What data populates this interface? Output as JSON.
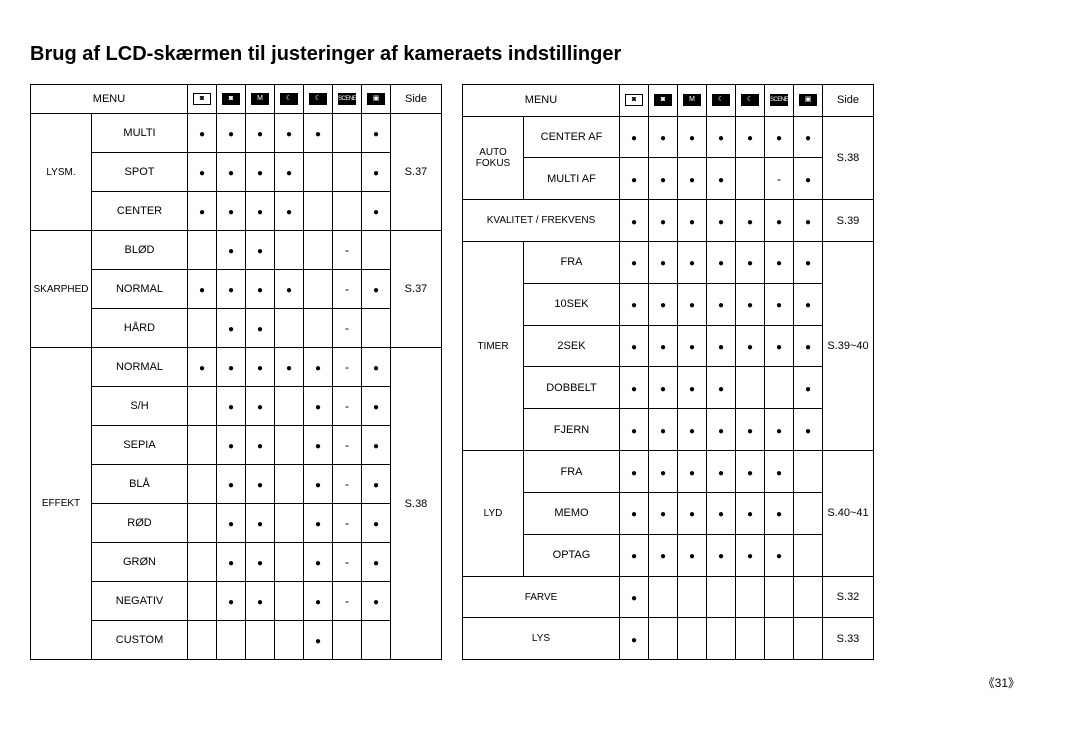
{
  "page_title": "Brug af LCD-skærmen til justeringer af kameraets indstillinger",
  "page_number": "《31》",
  "headers": {
    "menu": "MENU",
    "side": "Side",
    "mode_icons": [
      "cam",
      "cam2",
      "M",
      "night",
      "night2",
      "SCENE",
      "movie"
    ]
  },
  "table_left": {
    "groups": [
      {
        "name": "LYSM.",
        "side": "S.37",
        "rows": [
          {
            "label": "MULTI",
            "cells": [
              "d",
              "d",
              "d",
              "d",
              "d",
              "",
              "d"
            ]
          },
          {
            "label": "SPOT",
            "cells": [
              "d",
              "d",
              "d",
              "d",
              "",
              "",
              "d"
            ]
          },
          {
            "label": "CENTER",
            "cells": [
              "d",
              "d",
              "d",
              "d",
              "",
              "",
              "d"
            ]
          }
        ]
      },
      {
        "name": "SKARPHED",
        "side": "S.37",
        "rows": [
          {
            "label": "BLØD",
            "cells": [
              "",
              "d",
              "d",
              "",
              "",
              "-",
              ""
            ]
          },
          {
            "label": "NORMAL",
            "cells": [
              "d",
              "d",
              "d",
              "d",
              "",
              "-",
              "d"
            ]
          },
          {
            "label": "HÅRD",
            "cells": [
              "",
              "d",
              "d",
              "",
              "",
              "-",
              ""
            ]
          }
        ]
      },
      {
        "name": "EFFEKT",
        "side": "S.38",
        "rows": [
          {
            "label": "NORMAL",
            "cells": [
              "d",
              "d",
              "d",
              "d",
              "d",
              "-",
              "d"
            ]
          },
          {
            "label": "S/H",
            "cells": [
              "",
              "d",
              "d",
              "",
              "d",
              "-",
              "d"
            ]
          },
          {
            "label": "SEPIA",
            "cells": [
              "",
              "d",
              "d",
              "",
              "d",
              "-",
              "d"
            ]
          },
          {
            "label": "BLÅ",
            "cells": [
              "",
              "d",
              "d",
              "",
              "d",
              "-",
              "d"
            ]
          },
          {
            "label": "RØD",
            "cells": [
              "",
              "d",
              "d",
              "",
              "d",
              "-",
              "d"
            ]
          },
          {
            "label": "GRØN",
            "cells": [
              "",
              "d",
              "d",
              "",
              "d",
              "-",
              "d"
            ]
          },
          {
            "label": "NEGATIV",
            "cells": [
              "",
              "d",
              "d",
              "",
              "d",
              "-",
              "d"
            ]
          },
          {
            "label": "CUSTOM",
            "cells": [
              "",
              "",
              "",
              "",
              "d",
              "",
              ""
            ]
          }
        ]
      }
    ]
  },
  "table_right": {
    "groups": [
      {
        "name": "AUTO FOKUS",
        "side": "S.38",
        "rows": [
          {
            "label": "CENTER AF",
            "cells": [
              "d",
              "d",
              "d",
              "d",
              "d",
              "d",
              "d"
            ]
          },
          {
            "label": "MULTI AF",
            "cells": [
              "d",
              "d",
              "d",
              "d",
              "",
              "-",
              "d"
            ]
          }
        ]
      },
      {
        "name_span": "KVALITET / FREKVENS",
        "side": "S.39",
        "rows": [
          {
            "label_full": true,
            "cells": [
              "d",
              "d",
              "d",
              "d",
              "d",
              "d",
              "d"
            ]
          }
        ]
      },
      {
        "name": "TIMER",
        "side": "S.39~40",
        "rows": [
          {
            "label": "FRA",
            "cells": [
              "d",
              "d",
              "d",
              "d",
              "d",
              "d",
              "d"
            ]
          },
          {
            "label": "10SEK",
            "cells": [
              "d",
              "d",
              "d",
              "d",
              "d",
              "d",
              "d"
            ]
          },
          {
            "label": "2SEK",
            "cells": [
              "d",
              "d",
              "d",
              "d",
              "d",
              "d",
              "d"
            ]
          },
          {
            "label": "DOBBELT",
            "cells": [
              "d",
              "d",
              "d",
              "d",
              "",
              "",
              "d"
            ]
          },
          {
            "label": "FJERN",
            "cells": [
              "d",
              "d",
              "d",
              "d",
              "d",
              "d",
              "d"
            ]
          }
        ]
      },
      {
        "name": "LYD",
        "side": "S.40~41",
        "rows": [
          {
            "label": "FRA",
            "cells": [
              "d",
              "d",
              "d",
              "d",
              "d",
              "d",
              ""
            ]
          },
          {
            "label": "MEMO",
            "cells": [
              "d",
              "d",
              "d",
              "d",
              "d",
              "d",
              ""
            ]
          },
          {
            "label": "OPTAG",
            "cells": [
              "d",
              "d",
              "d",
              "d",
              "d",
              "d",
              ""
            ]
          }
        ]
      },
      {
        "name_span": "FARVE",
        "side": "S.32",
        "rows": [
          {
            "label_full": true,
            "cells": [
              "d",
              "",
              "",
              "",
              "",
              "",
              ""
            ]
          }
        ]
      },
      {
        "name_span": "LYS",
        "side": "S.33",
        "rows": [
          {
            "label_full": true,
            "cells": [
              "d",
              "",
              "",
              "",
              "",
              "",
              ""
            ]
          }
        ]
      }
    ]
  }
}
